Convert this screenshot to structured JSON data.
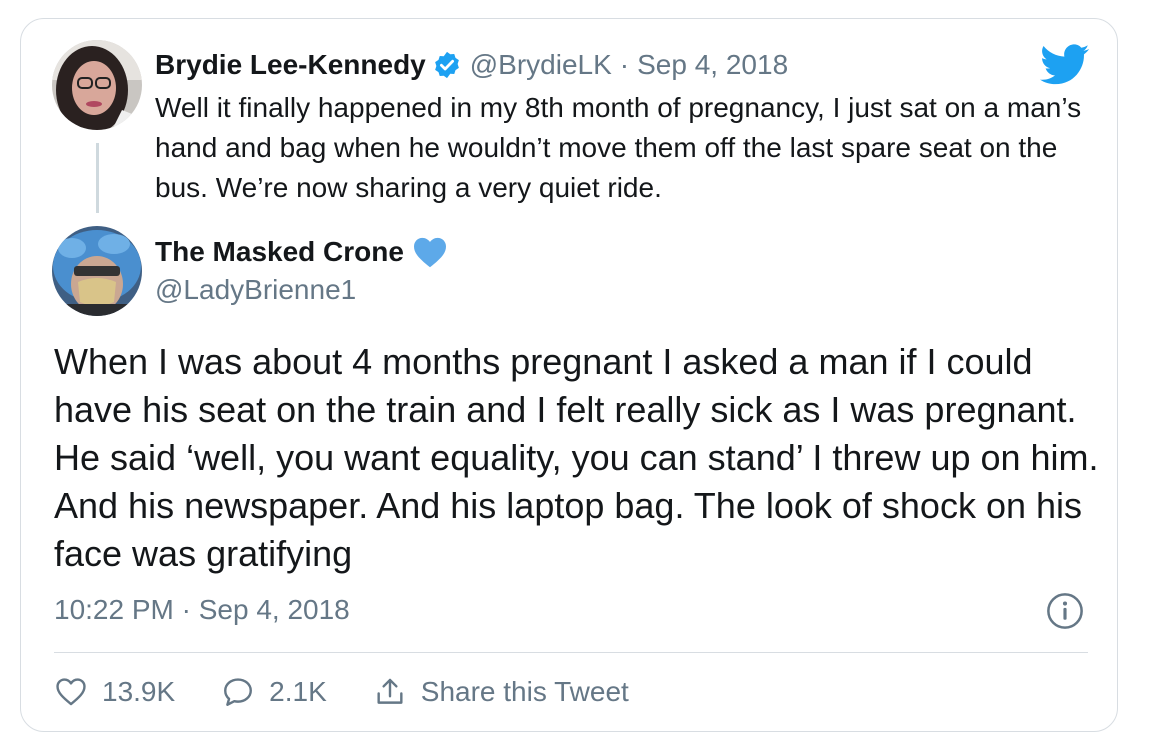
{
  "quoted_tweet": {
    "author_name": "Brydie Lee-Kennedy",
    "handle": "@BrydieLK",
    "separator": "·",
    "date": "Sep 4, 2018",
    "text": "Well it finally happened in my 8th month of pregnancy, I just sat on a man’s hand and bag when he wouldn’t move them off the last spare seat on the bus. We’re now sharing a very quiet ride."
  },
  "main_tweet": {
    "author_name": "The Masked Crone",
    "handle": "@LadyBrienne1",
    "text": "When I was about 4 months pregnant I asked a man if I could have his seat on the train and I felt really sick as I was pregnant. He said ‘well, you want equality, you can stand’ I threw up on him. And his newspaper. And his laptop bag. The look of shock on his face was gratifying",
    "timestamp": "10:22 PM · Sep 4, 2018"
  },
  "actions": {
    "likes": "13.9K",
    "replies": "2.1K",
    "share_label": "Share this Tweet"
  },
  "icons": {
    "verified": "verified-badge-icon",
    "bird": "twitter-bird-icon",
    "heart_emoji": "blue-heart-icon",
    "info": "info-icon",
    "like": "heart-outline-icon",
    "reply": "speech-bubble-icon",
    "share": "share-upload-icon"
  },
  "colors": {
    "brand_blue": "#1da1f2",
    "muted_text": "#657786",
    "primary_text": "#14171a",
    "heart_blue": "#5da9e9"
  }
}
